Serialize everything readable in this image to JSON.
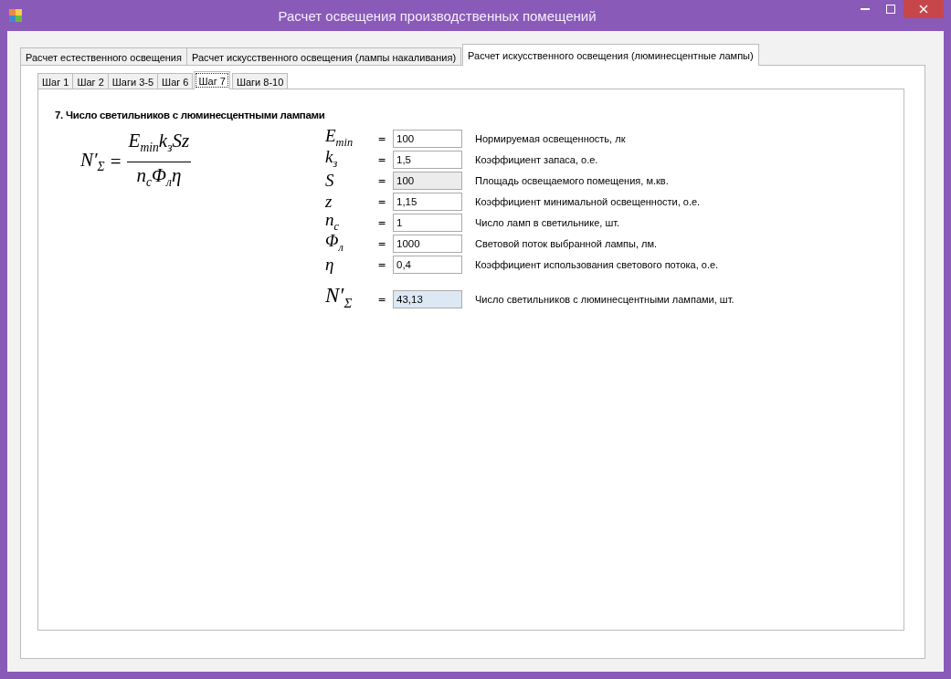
{
  "window": {
    "title": "Расчет освещения производственных помещений"
  },
  "tabs": [
    {
      "label": "Расчет естественного освещения",
      "selected": false
    },
    {
      "label": "Расчет искусственного освещения (лампы накаливания)",
      "selected": false
    },
    {
      "label": "Расчет искусственного освещения (люминесцентные лампы)",
      "selected": true
    }
  ],
  "step_tabs": [
    {
      "label": "Шаг 1",
      "selected": false
    },
    {
      "label": "Шаг 2",
      "selected": false
    },
    {
      "label": "Шаги 3-5",
      "selected": false
    },
    {
      "label": "Шаг 6",
      "selected": false
    },
    {
      "label": "Шаг 7",
      "selected": true
    },
    {
      "label": "Шаги 8-10",
      "selected": false
    }
  ],
  "section_title": "7. Число светильников с люминесцентными лампами",
  "formula": {
    "left": "N′$_{Σ}$",
    "sign": "=",
    "numerator": "E$_{min}$k$_{з}$Sz",
    "denominator": "n$_{c}$Φ$_{л}$η"
  },
  "parameters": [
    {
      "kind": "input",
      "symbol": "E$_{min}$",
      "equals": "=",
      "value": "100",
      "description": "Нормируемая освещенность, лк"
    },
    {
      "kind": "input",
      "symbol": "k$_{з}$",
      "equals": "=",
      "value": "1,5",
      "description": "Коэффициент запаса, о.е."
    },
    {
      "kind": "readonly",
      "symbol": "S",
      "equals": "=",
      "value": "100",
      "description": "Площадь освещаемого помещения, м.кв."
    },
    {
      "kind": "input",
      "symbol": "z",
      "equals": "=",
      "value": "1,15",
      "description": "Коэффициент минимальной освещенности, о.е."
    },
    {
      "kind": "input",
      "symbol": "n$_{c}$",
      "equals": "=",
      "value": "1",
      "description": "Число ламп в светильнике, шт."
    },
    {
      "kind": "input",
      "symbol": "Φ$_{л}$",
      "equals": "=",
      "value": "1000",
      "description": "Световой поток выбранной лампы, лм."
    },
    {
      "kind": "input",
      "symbol": "η",
      "equals": "=",
      "value": "0,4",
      "description": "Коэффициент использования светового потока, о.е."
    },
    {
      "kind": "result",
      "symbol": "N′$_{Σ}$",
      "equals": "=",
      "value": "43,13",
      "description": "Число светильников с люминесцентными лампами, шт."
    }
  ]
}
